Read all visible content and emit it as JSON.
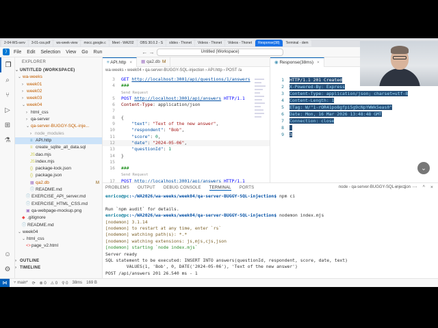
{
  "browser_tabs": [
    "2-04-WS-serv",
    "3-01-css.pdf",
    "ws-week-view",
    "mocc.google.c",
    "Meet - WA202",
    "OBS 30.0.2 - S",
    "slides - Thonet",
    "Videos - Thonet",
    "Videos - Thonet",
    "Response(38)",
    "Terminal - dem"
  ],
  "menu": [
    "File",
    "Edit",
    "Selection",
    "View",
    "Go",
    "Run"
  ],
  "nav_arrows": "← →",
  "command_center": "Untitled (Workspace)",
  "sidebar": {
    "title": "EXPLORER",
    "workspace": "UNTITLED (WORKSPACE)",
    "rows": [
      {
        "label": "wa-weeks",
        "indent": 0,
        "type": "folder-open",
        "color": "orange"
      },
      {
        "label": "week01",
        "indent": 1,
        "type": "folder",
        "color": "orange"
      },
      {
        "label": "week02",
        "indent": 1,
        "type": "folder",
        "color": "orange"
      },
      {
        "label": "week03",
        "indent": 1,
        "type": "folder",
        "color": "orange"
      },
      {
        "label": "week04",
        "indent": 1,
        "type": "folder-open",
        "color": "orange"
      },
      {
        "label": "html_css",
        "indent": 2,
        "type": "folder",
        "color": ""
      },
      {
        "label": "qa-server",
        "indent": 2,
        "type": "folder",
        "color": ""
      },
      {
        "label": "qa-server-BUGGY-SQL-inje...",
        "indent": 2,
        "type": "folder-open",
        "color": "orange"
      },
      {
        "label": "node_modules",
        "indent": 3,
        "type": "folder",
        "color": "gray"
      },
      {
        "label": "API.http",
        "indent": 3,
        "type": "file",
        "icon": "≡",
        "iconColor": "blue",
        "selected": true
      },
      {
        "label": "create_sqlite_all_data.sql",
        "indent": 3,
        "type": "file",
        "icon": "≡",
        "iconColor": "yellow"
      },
      {
        "label": "dao.mjs",
        "indent": 3,
        "type": "file",
        "icon": "JS",
        "iconColor": "yellow"
      },
      {
        "label": "index.mjs",
        "indent": 3,
        "type": "file",
        "icon": "JS",
        "iconColor": "yellow"
      },
      {
        "label": "package-lock.json",
        "indent": 3,
        "type": "file",
        "icon": "{}",
        "iconColor": "yellow"
      },
      {
        "label": "package.json",
        "indent": 3,
        "type": "file",
        "icon": "{}",
        "iconColor": "yellow"
      },
      {
        "label": "qa2.db",
        "indent": 3,
        "type": "file",
        "icon": "▦",
        "iconColor": "purple",
        "mod": "M",
        "color": "orange"
      },
      {
        "label": "README.md",
        "indent": 3,
        "type": "file",
        "icon": "ⓘ",
        "iconColor": "blue"
      },
      {
        "label": "EXERCISE_API_server.md",
        "indent": 2,
        "type": "file",
        "icon": "ⓘ",
        "iconColor": "blue"
      },
      {
        "label": "EXERCISE_HTML_CSS.md",
        "indent": 2,
        "type": "file",
        "icon": "ⓘ",
        "iconColor": "blue"
      },
      {
        "label": "qa-webpage-mockup.png",
        "indent": 2,
        "type": "file",
        "icon": "▣",
        "iconColor": "purple"
      },
      {
        "label": ".gitignore",
        "indent": 1,
        "type": "file",
        "icon": "◆",
        "iconColor": "red"
      },
      {
        "label": "README.md",
        "indent": 1,
        "type": "file",
        "icon": "ⓘ",
        "iconColor": "blue"
      },
      {
        "label": "week04",
        "indent": 0,
        "type": "folder-open",
        "color": ""
      },
      {
        "label": "html_css",
        "indent": 1,
        "type": "folder-open",
        "color": ""
      },
      {
        "label": "page_v2.html",
        "indent": 2,
        "type": "file",
        "icon": "<>",
        "iconColor": "red"
      }
    ],
    "outline": "OUTLINE",
    "timeline": "TIMELINE"
  },
  "editor1": {
    "tabs": [
      {
        "label": "API.http",
        "active": true,
        "mod": ""
      },
      {
        "label": "qa2.db",
        "active": false,
        "mod": "M"
      }
    ],
    "breadcrumb": "wa-weeks › week04 › qa-server-BUGGY-SQL-injection › API.http › POST /a",
    "send_request": "Send Request"
  },
  "editor2": {
    "tab": "Response(38ms)",
    "lines": [
      "HTTP/1.1 201 Created",
      "X-Powered-By: Express",
      "Content-Type: application/json; charset=utf-8",
      "Content-Length: 1",
      "ETag: W/\"1-rOR41po8gfpi5g9cNpYWWk5eas0\"",
      "Date: Mon, 16 Mar 2026 13:48:48 GMT",
      "Connection: close",
      "",
      "3"
    ]
  },
  "panel": {
    "tabs": [
      "PROBLEMS",
      "OUTPUT",
      "DEBUG CONSOLE",
      "TERMINAL",
      "PORTS"
    ],
    "terminal_selector": "node - qa-server-BUGGY-SQL-injection",
    "prompt_user": "enrico@pc",
    "prompt_path": ":~/WA2026/wa-weeks/week04/qa-server-BUGGY-SQL-injection$",
    "cmd1": " npm ci",
    "npm_audit": "Run `npm audit` for details.",
    "cmd2": " nodemon index.mjs",
    "nodemon_lines": [
      "[nodemon] 3.1.14",
      "[nodemon] to restart at any time, enter `rs`",
      "[nodemon] watching path(s): *.*",
      "[nodemon] watching extensions: js,mjs,cjs,json",
      "[nodemon] starting `node index.mjs`"
    ],
    "server_ready": "Server ready",
    "sql_line1": "SQL statement to be executed: INSERT INTO answers(questionId, respondent, score, date, text)",
    "sql_line2": "        VALUES(1, 'Bob', 0, DATE('2024-05-06'), 'Text of the new answer')",
    "post_log": "POST /api/answers 201 26.540 ms - 1"
  },
  "statusbar": {
    "branch": "main*",
    "sync": "⟳",
    "errors": "⊗ 0",
    "warnings": "⚠ 0",
    "ports": "⚲ 0",
    "time": "38ms",
    "size": "169 B"
  }
}
